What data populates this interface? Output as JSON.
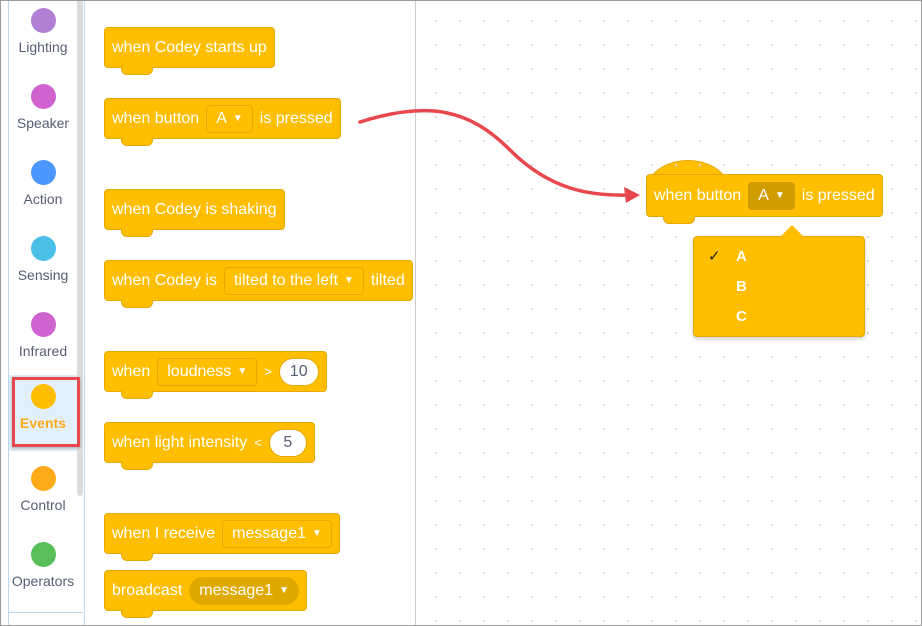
{
  "categories": [
    {
      "label": "Lighting",
      "color": "#b07fd6"
    },
    {
      "label": "Speaker",
      "color": "#cf63cf"
    },
    {
      "label": "Action",
      "color": "#4c97ff"
    },
    {
      "label": "Sensing",
      "color": "#4cbfe6"
    },
    {
      "label": "Infrared",
      "color": "#cf63cf"
    },
    {
      "label": "Events",
      "color": "#ffbf00",
      "active": true
    },
    {
      "label": "Control",
      "color": "#ffab19"
    },
    {
      "label": "Operators",
      "color": "#59c059"
    }
  ],
  "palette": {
    "b1": {
      "text": "when Codey starts up"
    },
    "b2": {
      "pre": "when button",
      "dd": "A",
      "post": "is pressed"
    },
    "b3": {
      "text": "when Codey is shaking"
    },
    "b4": {
      "pre": "when Codey is",
      "dd": "tilted to the left",
      "post": "tilted"
    },
    "b5": {
      "pre": "when",
      "dd": "loudness",
      "op": ">",
      "value": "10"
    },
    "b6": {
      "pre": "when light intensity",
      "op": "<",
      "value": "5"
    },
    "b7": {
      "pre": "when I receive",
      "dd": "message1"
    },
    "b8": {
      "pre": "broadcast",
      "dd": "message1"
    }
  },
  "workspace": {
    "block": {
      "pre": "when button",
      "dd": "A",
      "post": "is pressed"
    },
    "menu": {
      "options": [
        "A",
        "B",
        "C"
      ],
      "selected": "A",
      "check": "✓"
    }
  },
  "colors": {
    "event_block": "#ffbf00",
    "highlight": "#e8474d",
    "arrow": "#e8474d"
  }
}
